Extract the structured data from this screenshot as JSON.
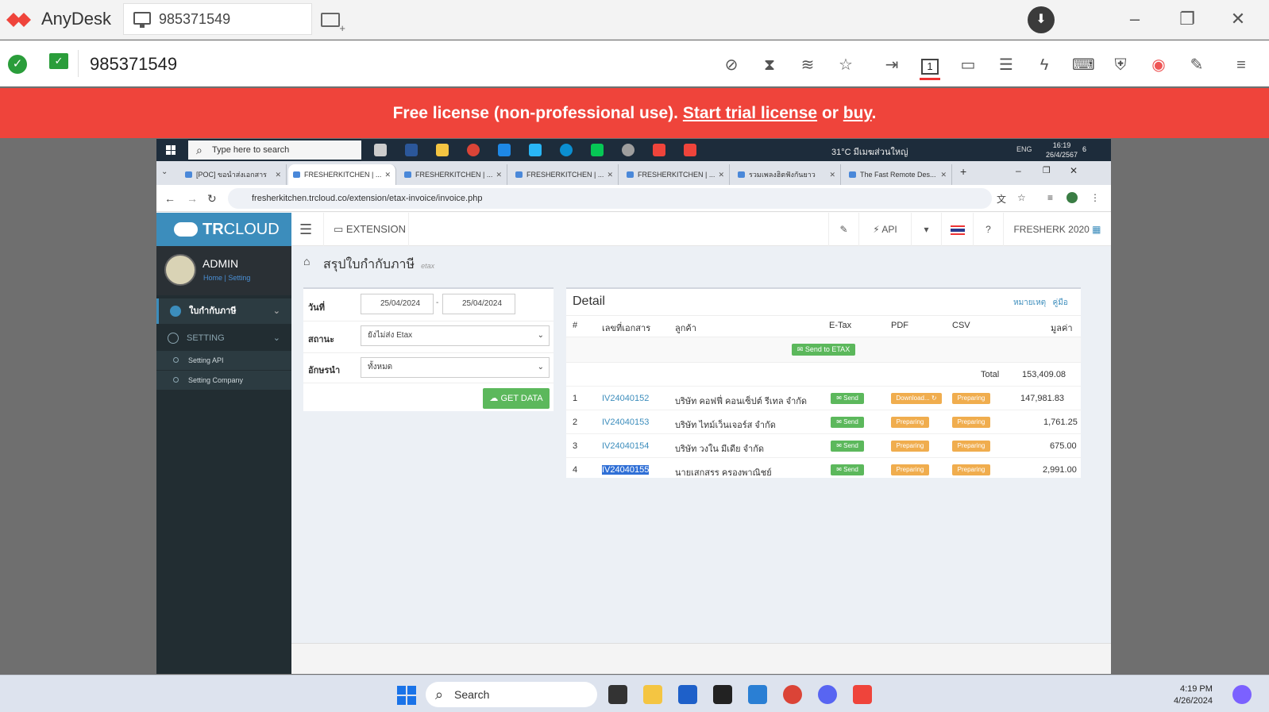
{
  "anydesk": {
    "app_name": "AnyDesk",
    "address_value": "985371549",
    "remote_id": "985371549",
    "banner_text_1": "Free license (non-professional use).",
    "banner_link_trial": "Start trial license",
    "banner_or": "or",
    "banner_link_buy": "buy",
    "banner_end": ".",
    "toolbar_active_label": "1"
  },
  "remote_taskbar": {
    "search_placeholder": "Type here to search",
    "weather": "31°C มีเมฆส่วนใหญ่",
    "language": "ENG",
    "time": "16:19",
    "date": "26/4/2567",
    "notifications": "6"
  },
  "browser": {
    "tabs": [
      {
        "title": "[POC] ขอนำส่งเอกสาร"
      },
      {
        "title": "FRESHERKITCHEN | ..."
      },
      {
        "title": "FRESHERKITCHEN | ..."
      },
      {
        "title": "FRESHERKITCHEN | ..."
      },
      {
        "title": "FRESHERKITCHEN | ..."
      },
      {
        "title": "รวมเพลงฮิตฟังกันยาว"
      },
      {
        "title": "The Fast Remote Des..."
      }
    ],
    "url": "fresherkitchen.trcloud.co/extension/etax-invoice/invoice.php"
  },
  "app": {
    "logo_bold": "TR",
    "logo_rest": "CLOUD",
    "extension_label": "EXTENSION",
    "api_label": "API",
    "company": "FRESHERK 2020",
    "sidebar": {
      "user": "ADMIN",
      "link_home": "Home",
      "link_setting": "Setting",
      "menu1": "ใบกำกับภาษี",
      "menu2": "SETTING",
      "sub1": "Setting API",
      "sub2": "Setting Company"
    },
    "page_title": "สรุปใบกำกับภาษี",
    "page_subtitle": "etax",
    "form": {
      "date_label": "วันที่",
      "date_from": "25/04/2024",
      "date_to": "25/04/2024",
      "date_sep": "-",
      "status_label": "สถานะ",
      "status_value": "ยังไม่ส่ง Etax",
      "prefix_label": "อักษรนำ",
      "prefix_value": "ทั้งหมด",
      "get_data": "GET DATA"
    },
    "detail": {
      "title": "Detail",
      "link_note": "หมายเหตุ",
      "link_manual": "คู่มือ",
      "headers": {
        "no": "#",
        "doc": "เลขที่เอกสาร",
        "customer": "ลูกค้า",
        "etax": "E-Tax",
        "pdf": "PDF",
        "csv": "CSV",
        "value": "มูลค่า"
      },
      "send_to_etax": "Send to ETAX",
      "total_label": "Total",
      "total_value": "153,409.08",
      "rows": [
        {
          "no": "1",
          "doc": "IV24040152",
          "customer": "บริษัท คอฟฟี่ คอนเซ็ปต์ รีเทล จำกัด",
          "etax": "Send",
          "pdf": "Download...",
          "csv": "Preparing",
          "value": "147,981.83"
        },
        {
          "no": "2",
          "doc": "IV24040153",
          "customer": "บริษัท ไทม์เว็นเจอร์ส จำกัด",
          "etax": "Send",
          "pdf": "Preparing",
          "csv": "Preparing",
          "value": "1,761.25"
        },
        {
          "no": "3",
          "doc": "IV24040154",
          "customer": "บริษัท วงใน มีเดีย จำกัด",
          "etax": "Send",
          "pdf": "Preparing",
          "csv": "Preparing",
          "value": "675.00"
        },
        {
          "no": "4",
          "doc": "IV24040155",
          "customer": "นายเสกสรร ครองพาณิชย์",
          "etax": "Send",
          "pdf": "Preparing",
          "csv": "Preparing",
          "value": "2,991.00"
        }
      ]
    }
  },
  "host_taskbar": {
    "search_placeholder": "Search",
    "time": "4:19 PM",
    "date": "4/26/2024"
  },
  "colors": {
    "anydesk_red": "#ef443b",
    "trcloud_blue": "#3c8dbc",
    "green": "#5cb85c",
    "orange": "#f0ad4e"
  }
}
